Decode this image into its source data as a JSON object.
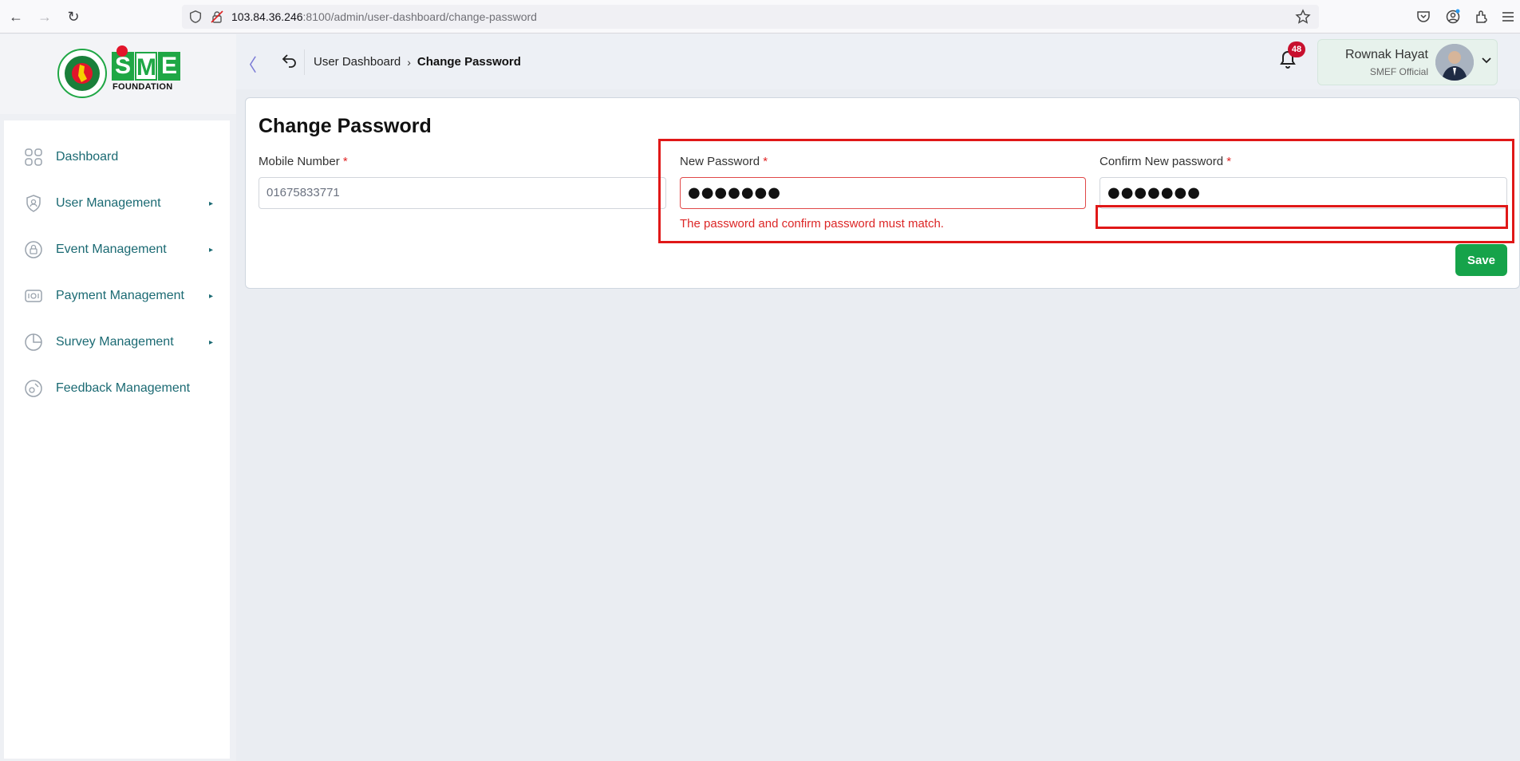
{
  "browser": {
    "url_host": "103.84.36.246",
    "url_path": ":8100/admin/user-dashboard/change-password"
  },
  "logo": {
    "letters": [
      "S",
      "M",
      "E"
    ],
    "subtitle": "FOUNDATION"
  },
  "sidebar": {
    "items": [
      {
        "label": "Dashboard",
        "icon": "grid-icon",
        "has_submenu": false
      },
      {
        "label": "User Management",
        "icon": "user-shield-icon",
        "has_submenu": true
      },
      {
        "label": "Event Management",
        "icon": "lock-circle-icon",
        "has_submenu": true
      },
      {
        "label": "Payment Management",
        "icon": "money-icon",
        "has_submenu": true
      },
      {
        "label": "Survey Management",
        "icon": "pie-chart-icon",
        "has_submenu": true
      },
      {
        "label": "Feedback Management",
        "icon": "feedback-icon",
        "has_submenu": false
      }
    ]
  },
  "header": {
    "collapse_icon": "chevron-left-icon",
    "back_icon": "undo-icon",
    "breadcrumb_parent": "User Dashboard",
    "breadcrumb_current": "Change Password",
    "notification_count": "48",
    "user_name": "Rownak Hayat",
    "user_role": "SMEF Official"
  },
  "form": {
    "title": "Change Password",
    "mobile_label": "Mobile Number",
    "mobile_value": "01675833771",
    "new_password_label": "New Password",
    "new_password_value": "●●●●●●●",
    "confirm_password_label": "Confirm New password",
    "confirm_password_value": "●●●●●●●",
    "required_mark": "*",
    "error_message": "The password and confirm password must match.",
    "save_label": "Save"
  },
  "colors": {
    "accent_teal": "#1b6a73",
    "save_green": "#16a34a",
    "error_red": "#dc2626",
    "annotation_red": "#e01818",
    "badge_red": "#c8102e"
  }
}
